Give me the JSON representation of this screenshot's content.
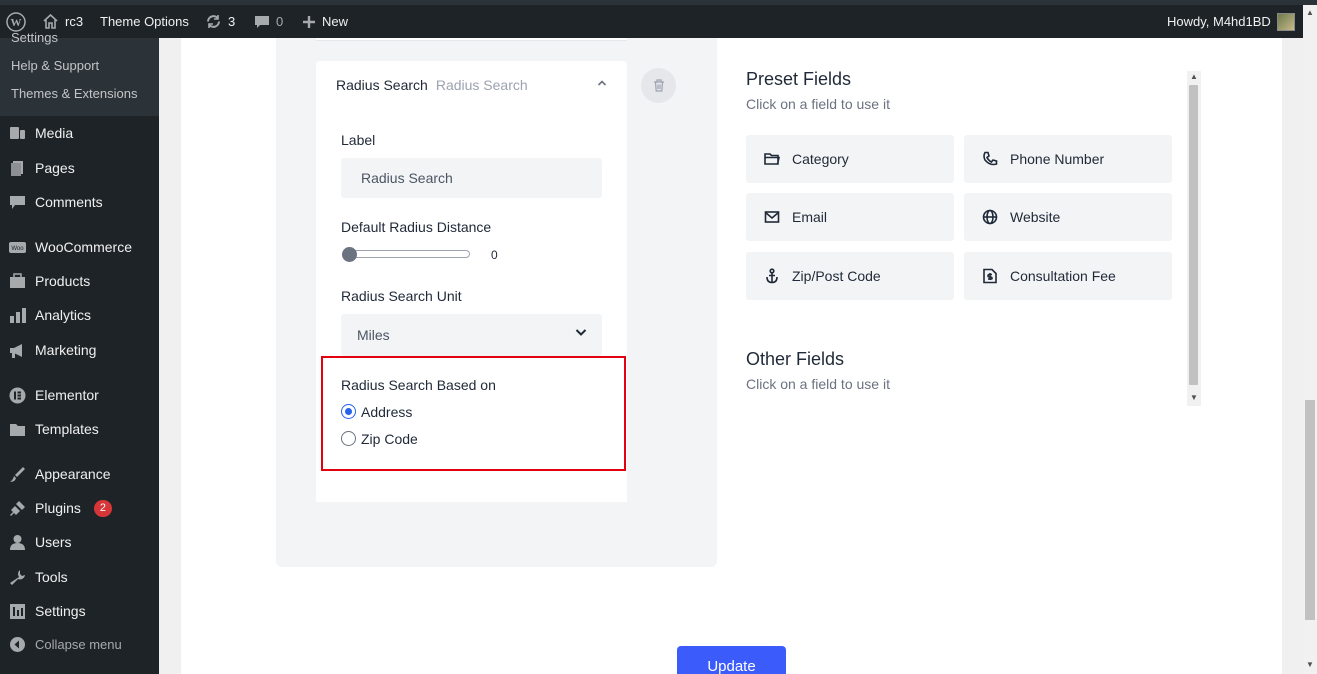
{
  "adminbar": {
    "site_name": "rc3",
    "theme_options": "Theme Options",
    "updates_count": "3",
    "comments_count": "0",
    "new_label": "New",
    "howdy": "Howdy, M4hd1BD"
  },
  "sidebar": {
    "submenu": [
      "Settings",
      "Help & Support",
      "Themes & Extensions"
    ],
    "items": [
      {
        "label": "Media",
        "icon": "media-icon"
      },
      {
        "label": "Pages",
        "icon": "pages-icon"
      },
      {
        "label": "Comments",
        "icon": "comments-icon"
      },
      {
        "label": "WooCommerce",
        "icon": "woocommerce-icon"
      },
      {
        "label": "Products",
        "icon": "products-icon"
      },
      {
        "label": "Analytics",
        "icon": "analytics-icon"
      },
      {
        "label": "Marketing",
        "icon": "marketing-icon"
      },
      {
        "label": "Elementor",
        "icon": "elementor-icon"
      },
      {
        "label": "Templates",
        "icon": "templates-icon"
      },
      {
        "label": "Appearance",
        "icon": "appearance-icon"
      },
      {
        "label": "Plugins",
        "icon": "plugins-icon",
        "badge": "2"
      },
      {
        "label": "Users",
        "icon": "users-icon"
      },
      {
        "label": "Tools",
        "icon": "tools-icon"
      },
      {
        "label": "Settings",
        "icon": "settings-icon"
      }
    ],
    "collapse": "Collapse menu"
  },
  "field_card": {
    "title": "Radius Search",
    "subtitle": "Radius Search",
    "label_label": "Label",
    "label_value": "Radius Search",
    "distance_label": "Default Radius Distance",
    "distance_value": "0",
    "unit_label": "Radius Search Unit",
    "unit_value": "Miles",
    "based_on_label": "Radius Search Based on",
    "options": [
      {
        "label": "Address",
        "checked": true
      },
      {
        "label": "Zip Code",
        "checked": false
      }
    ]
  },
  "preset": {
    "title": "Preset Fields",
    "subtitle": "Click on a field to use it",
    "fields": [
      {
        "label": "Category",
        "icon": "folder-icon"
      },
      {
        "label": "Phone Number",
        "icon": "phone-icon"
      },
      {
        "label": "Email",
        "icon": "email-icon"
      },
      {
        "label": "Website",
        "icon": "globe-icon"
      },
      {
        "label": "Zip/Post Code",
        "icon": "anchor-icon"
      },
      {
        "label": "Consultation Fee",
        "icon": "fee-icon"
      }
    ]
  },
  "other": {
    "title": "Other Fields",
    "subtitle": "Click on a field to use it"
  },
  "update_button": "Update",
  "colors": {
    "accent": "#3b5bfb",
    "highlight": "#e3000f",
    "radio_checked": "#2563eb",
    "admin_bg": "#1d2327",
    "badge": "#d63638"
  }
}
